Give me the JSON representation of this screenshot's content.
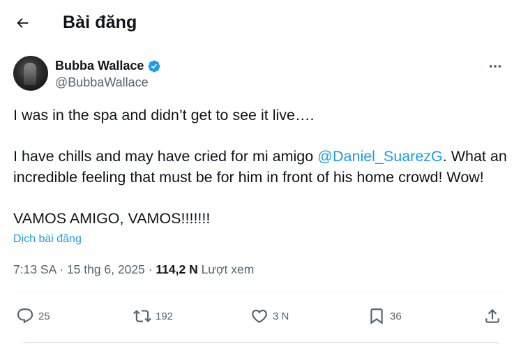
{
  "header": {
    "title": "Bài đăng"
  },
  "author": {
    "display_name": "Bubba Wallace",
    "handle": "@BubbaWallace"
  },
  "tweet": {
    "line1": "I was in the spa and didn’t get to see it live….",
    "line2_before": "I have chills and may have cried for mi amigo ",
    "mention": "@Daniel_SuarezG",
    "line2_after": ". What an",
    "line3": "incredible feeling that must be for him in front of his home crowd! Wow!",
    "line4": "VAMOS AMIGO, VAMOS!!!!!!!"
  },
  "translate_label": "Dịch bài đăng",
  "meta": {
    "time": "7:13 SA",
    "separator": "·",
    "date": "15 thg 6, 2025",
    "views_count": "114,2 N",
    "views_label": "Lượt xem"
  },
  "actions": {
    "replies": "25",
    "reposts": "192",
    "likes": "3 N",
    "bookmarks": "36"
  },
  "colors": {
    "accent": "#1d9bf0",
    "text": "#0f1419",
    "secondary": "#536471"
  }
}
